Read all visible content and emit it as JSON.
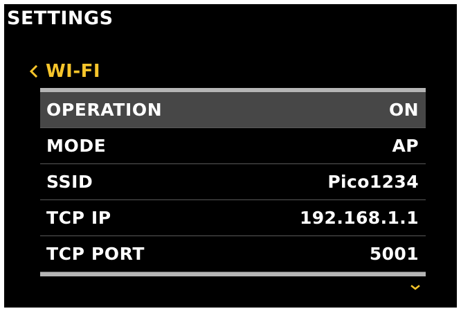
{
  "header": {
    "title": "SETTINGS"
  },
  "breadcrumb": {
    "back_icon": "chevron-left-icon",
    "label": "WI-FI"
  },
  "menu": {
    "items": [
      {
        "label": "OPERATION",
        "value": "ON",
        "selected": true
      },
      {
        "label": "MODE",
        "value": "AP",
        "selected": false
      },
      {
        "label": "SSID",
        "value": "Pico1234",
        "selected": false
      },
      {
        "label": "TCP IP",
        "value": "192.168.1.1",
        "selected": false
      },
      {
        "label": "TCP PORT",
        "value": "5001",
        "selected": false
      }
    ]
  },
  "scroll": {
    "icon": "chevron-down-icon"
  },
  "colors": {
    "background": "#000000",
    "accent": "#f7c52b",
    "selected_row": "#474747",
    "rule": "#b5b5b5",
    "text": "#ffffff"
  }
}
